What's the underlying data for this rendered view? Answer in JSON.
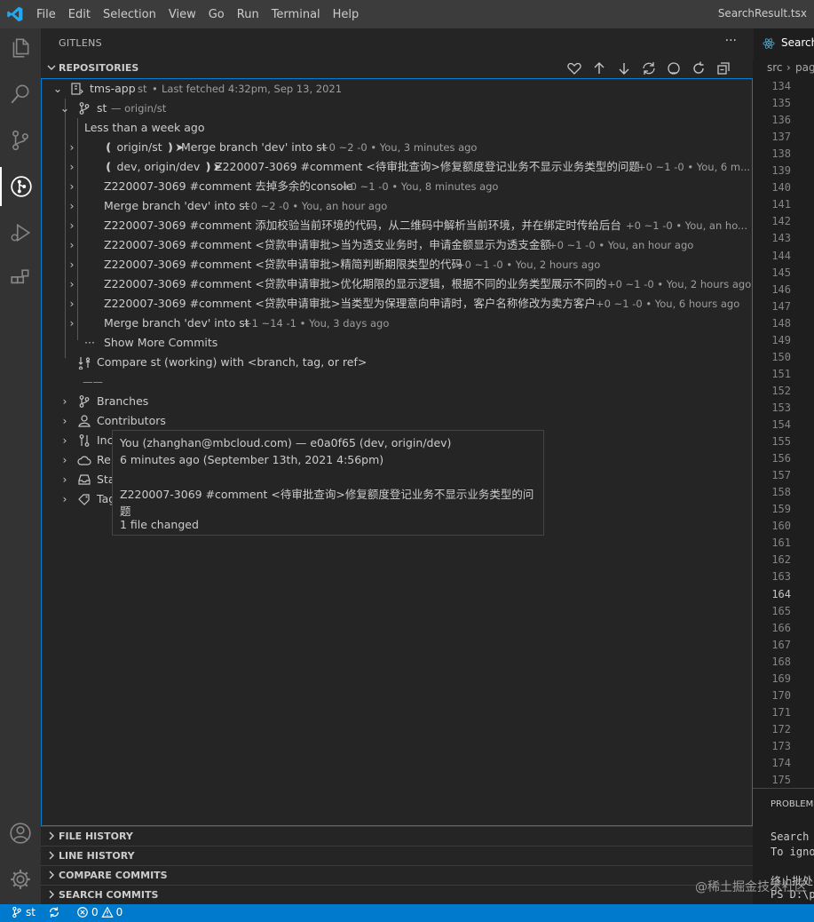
{
  "menu": [
    "File",
    "Edit",
    "Selection",
    "View",
    "Go",
    "Run",
    "Terminal",
    "Help"
  ],
  "window_title": "SearchResult.tsx",
  "sidebar": {
    "title": "GITLENS",
    "more": "···",
    "repositories_label": "REPOSITORIES"
  },
  "repo": {
    "name": "tms-app",
    "branch": "st",
    "fetched": "Last fetched 4:32pm, Sep 13, 2021"
  },
  "branch_node": {
    "name": "st",
    "tracking": "— origin/st"
  },
  "group_label": "Less than a week ago",
  "commits": [
    {
      "refs": "❪ origin/st ❫➤",
      "message": "Merge branch 'dev' into st",
      "meta": "+0 ~2 -0 • You, 3 minutes ago"
    },
    {
      "refs": "❪ dev, origin/dev ❫➤",
      "message": "Z220007-3069 #comment <待审批查询>修复额度登记业务不显示业务类型的问题",
      "meta": "+0 ~1 -0 • You, 6 m..."
    },
    {
      "refs": "",
      "message": "Z220007-3069 #comment 去掉多余的console",
      "meta": "+0 ~1 -0 • You, 8 minutes ago"
    },
    {
      "refs": "",
      "message": "Merge branch 'dev' into st",
      "meta": "+0 ~2 -0 • You, an hour ago"
    },
    {
      "refs": "",
      "message": "Z220007-3069 #comment 添加校验当前环境的代码，从二维码中解析当前环境，并在绑定时传给后台",
      "meta": "+0 ~1 -0 • You, an ho..."
    },
    {
      "refs": "",
      "message": "Z220007-3069 #comment <贷款申请审批>当为透支业务时，申请金额显示为透支金额",
      "meta": "+0 ~1 -0 • You, an hour ago"
    },
    {
      "refs": "",
      "message": "Z220007-3069 #comment <贷款申请审批>精简判断期限类型的代码",
      "meta": "+0 ~1 -0 • You, 2 hours ago"
    },
    {
      "refs": "",
      "message": "Z220007-3069 #comment <贷款申请审批>优化期限的显示逻辑，根据不同的业务类型展示不同的",
      "meta": "+0 ~1 -0 • You, 2 hours ago"
    },
    {
      "refs": "",
      "message": "Z220007-3069 #comment <贷款申请审批>当类型为保理意向申请时，客户名称修改为卖方客户",
      "meta": "+0 ~1 -0 • You, 6 hours ago"
    },
    {
      "refs": "",
      "message": "Merge branch 'dev' into st",
      "meta": "+1 ~14 -1 • You, 3 days ago"
    }
  ],
  "show_more": "Show More Commits",
  "compare_label": "Compare st (working) with <branch, tag, or ref>",
  "separator": "——",
  "nodes": {
    "branches": "Branches",
    "contributors": "Contributors",
    "incoming": "Inc",
    "remotes": "Ren",
    "stashes": "Sta",
    "tags": "Tag"
  },
  "hover": {
    "author": "You (zhanghan@mbcloud.com) — e0a0f65 (dev, origin/dev)",
    "date": "6 minutes ago (September 13th, 2021 4:56pm)",
    "message": "Z220007-3069 #comment <待审批查询>修复额度登记业务不显示业务类型的问题",
    "files": "1 file changed"
  },
  "panels": [
    "FILE HISTORY",
    "LINE HISTORY",
    "COMPARE COMMITS",
    "SEARCH COMMITS"
  ],
  "editor": {
    "tab_label": "Search",
    "crumb_src": "src",
    "crumb_next": "pag",
    "line_numbers": [
      "134",
      "135",
      "136",
      "137",
      "138",
      "139",
      "140",
      "141",
      "142",
      "143",
      "144",
      "145",
      "146",
      "147",
      "148",
      "149",
      "150",
      "151",
      "152",
      "153",
      "154",
      "155",
      "156",
      "157",
      "158",
      "159",
      "160",
      "161",
      "162",
      "163",
      "164",
      "165",
      "166",
      "167",
      "168",
      "169",
      "170",
      "171",
      "172",
      "173",
      "174",
      "175"
    ],
    "current_line": "164"
  },
  "terminal": {
    "panel_label": "PROBLEMS",
    "lines": [
      "Search",
      "To igno",
      "终止批处",
      "PS D:\\p"
    ]
  },
  "status": {
    "branch": "st",
    "errors": "0",
    "warnings": "0"
  },
  "watermark": "@稀土掘金技术社区",
  "colors": {
    "accent": "#007acc",
    "focus_border": "#007fd4"
  }
}
